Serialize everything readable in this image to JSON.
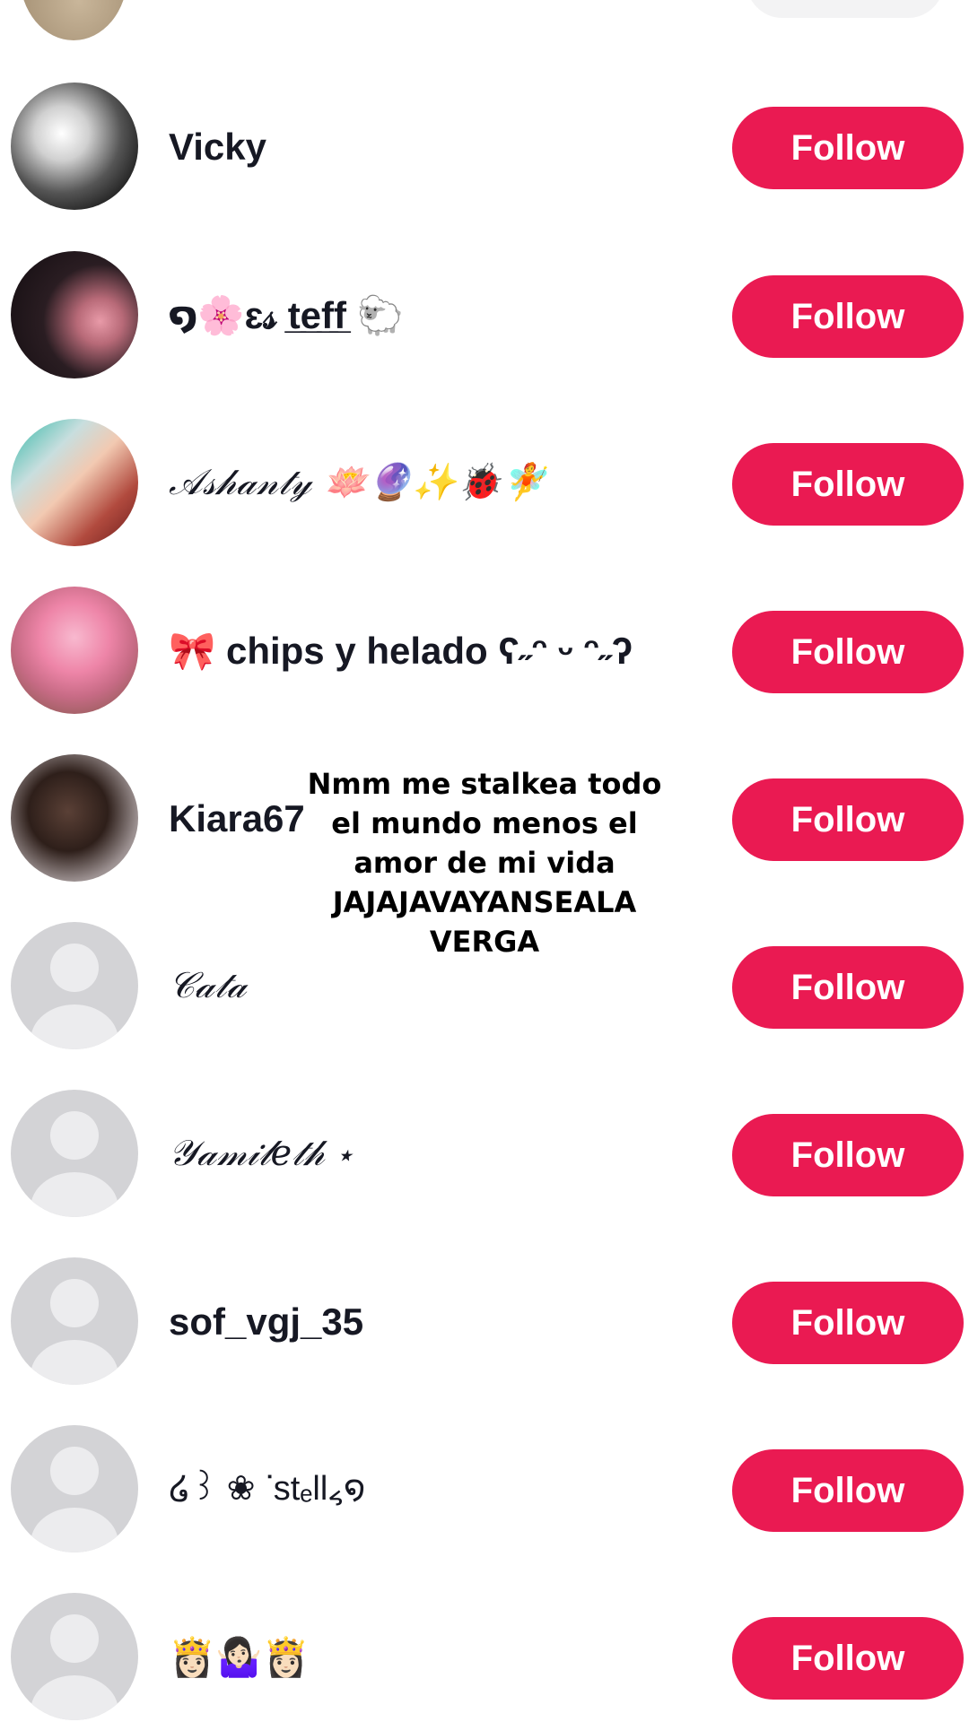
{
  "follow_label": "Follow",
  "overlay_caption": "Nmm me stalkea todo\nel mundo menos el\namor de mi vida\nJAJAJAVAYANSEALA\nVERGA",
  "users": [
    {
      "name": "Vicky",
      "avatar": "photo",
      "style": "bold"
    },
    {
      "name": "໑🌸ɛ𝓈 t̲e̲f̲f̲ 🐑",
      "avatar": "photo",
      "style": "bold"
    },
    {
      "name": "𝒜𝓈𝒽𝒶𝓃𝓉𝓎 🪷🔮✨🐞🧚",
      "avatar": "photo",
      "style": "script"
    },
    {
      "name": "🎀 chips y helado ʕ˶ᵔ ᵕ ᵔ˶ʔ",
      "avatar": "photo",
      "style": "bold"
    },
    {
      "name": "Kiara67",
      "avatar": "photo",
      "style": "bold"
    },
    {
      "name": "𝒞𝒶𝓉𝒶",
      "avatar": "default",
      "style": "script"
    },
    {
      "name": "𝒴𝒶𝓂𝒾𝓁𝑒𝓉𝒽 ⋆",
      "avatar": "default",
      "style": "script"
    },
    {
      "name": "sof_vgj_35",
      "avatar": "default",
      "style": "bold"
    },
    {
      "name": "໒꒱ ❀ ᐝstₑll៹໑",
      "avatar": "default",
      "style": "light"
    },
    {
      "name": "👸🏻🤷🏻‍♀️👸🏻",
      "avatar": "default",
      "style": "bold"
    }
  ],
  "colors": {
    "follow_bg": "#ea1a52",
    "follow_text": "#ffffff",
    "username_text": "#161823",
    "default_avatar_bg": "#d3d3d6"
  }
}
